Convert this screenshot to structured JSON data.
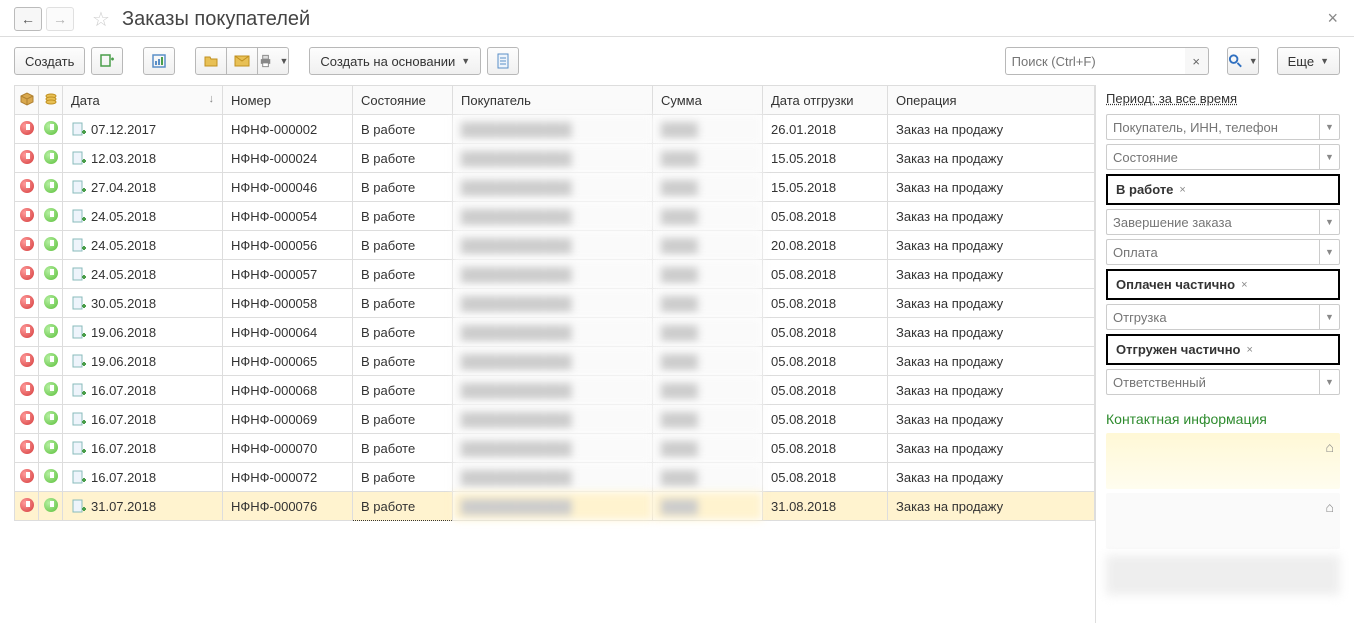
{
  "header": {
    "title": "Заказы покупателей"
  },
  "toolbar": {
    "create_label": "Создать",
    "create_based_label": "Создать на основании",
    "more_label": "Еще",
    "search_placeholder": "Поиск (Ctrl+F)"
  },
  "columns": {
    "date": "Дата",
    "number": "Номер",
    "state": "Состояние",
    "buyer": "Покупатель",
    "sum": "Сумма",
    "ship_date": "Дата отгрузки",
    "operation": "Операция"
  },
  "rows": [
    {
      "date": "07.12.2017",
      "number": "НФНФ-000002",
      "state": "В работе",
      "ship": "26.01.2018",
      "op": "Заказ на продажу",
      "selected": false
    },
    {
      "date": "12.03.2018",
      "number": "НФНФ-000024",
      "state": "В работе",
      "ship": "15.05.2018",
      "op": "Заказ на продажу",
      "selected": false
    },
    {
      "date": "27.04.2018",
      "number": "НФНФ-000046",
      "state": "В работе",
      "ship": "15.05.2018",
      "op": "Заказ на продажу",
      "selected": false
    },
    {
      "date": "24.05.2018",
      "number": "НФНФ-000054",
      "state": "В работе",
      "ship": "05.08.2018",
      "op": "Заказ на продажу",
      "selected": false
    },
    {
      "date": "24.05.2018",
      "number": "НФНФ-000056",
      "state": "В работе",
      "ship": "20.08.2018",
      "op": "Заказ на продажу",
      "selected": false
    },
    {
      "date": "24.05.2018",
      "number": "НФНФ-000057",
      "state": "В работе",
      "ship": "05.08.2018",
      "op": "Заказ на продажу",
      "selected": false
    },
    {
      "date": "30.05.2018",
      "number": "НФНФ-000058",
      "state": "В работе",
      "ship": "05.08.2018",
      "op": "Заказ на продажу",
      "selected": false
    },
    {
      "date": "19.06.2018",
      "number": "НФНФ-000064",
      "state": "В работе",
      "ship": "05.08.2018",
      "op": "Заказ на продажу",
      "selected": false
    },
    {
      "date": "19.06.2018",
      "number": "НФНФ-000065",
      "state": "В работе",
      "ship": "05.08.2018",
      "op": "Заказ на продажу",
      "selected": false
    },
    {
      "date": "16.07.2018",
      "number": "НФНФ-000068",
      "state": "В работе",
      "ship": "05.08.2018",
      "op": "Заказ на продажу",
      "selected": false
    },
    {
      "date": "16.07.2018",
      "number": "НФНФ-000069",
      "state": "В работе",
      "ship": "05.08.2018",
      "op": "Заказ на продажу",
      "selected": false
    },
    {
      "date": "16.07.2018",
      "number": "НФНФ-000070",
      "state": "В работе",
      "ship": "05.08.2018",
      "op": "Заказ на продажу",
      "selected": false
    },
    {
      "date": "16.07.2018",
      "number": "НФНФ-000072",
      "state": "В работе",
      "ship": "05.08.2018",
      "op": "Заказ на продажу",
      "selected": false
    },
    {
      "date": "31.07.2018",
      "number": "НФНФ-000076",
      "state": "В работе",
      "ship": "31.08.2018",
      "op": "Заказ на продажу",
      "selected": true
    }
  ],
  "sidebar": {
    "period": "Период: за все время",
    "buyer_placeholder": "Покупатель, ИНН, телефон",
    "state_placeholder": "Состояние",
    "state_tag": "В работе",
    "completion_placeholder": "Завершение заказа",
    "payment_placeholder": "Оплата",
    "payment_tag": "Оплачен частично",
    "shipment_placeholder": "Отгрузка",
    "shipment_tag": "Отгружен частично",
    "responsible_placeholder": "Ответственный",
    "contact_title": "Контактная информация"
  }
}
